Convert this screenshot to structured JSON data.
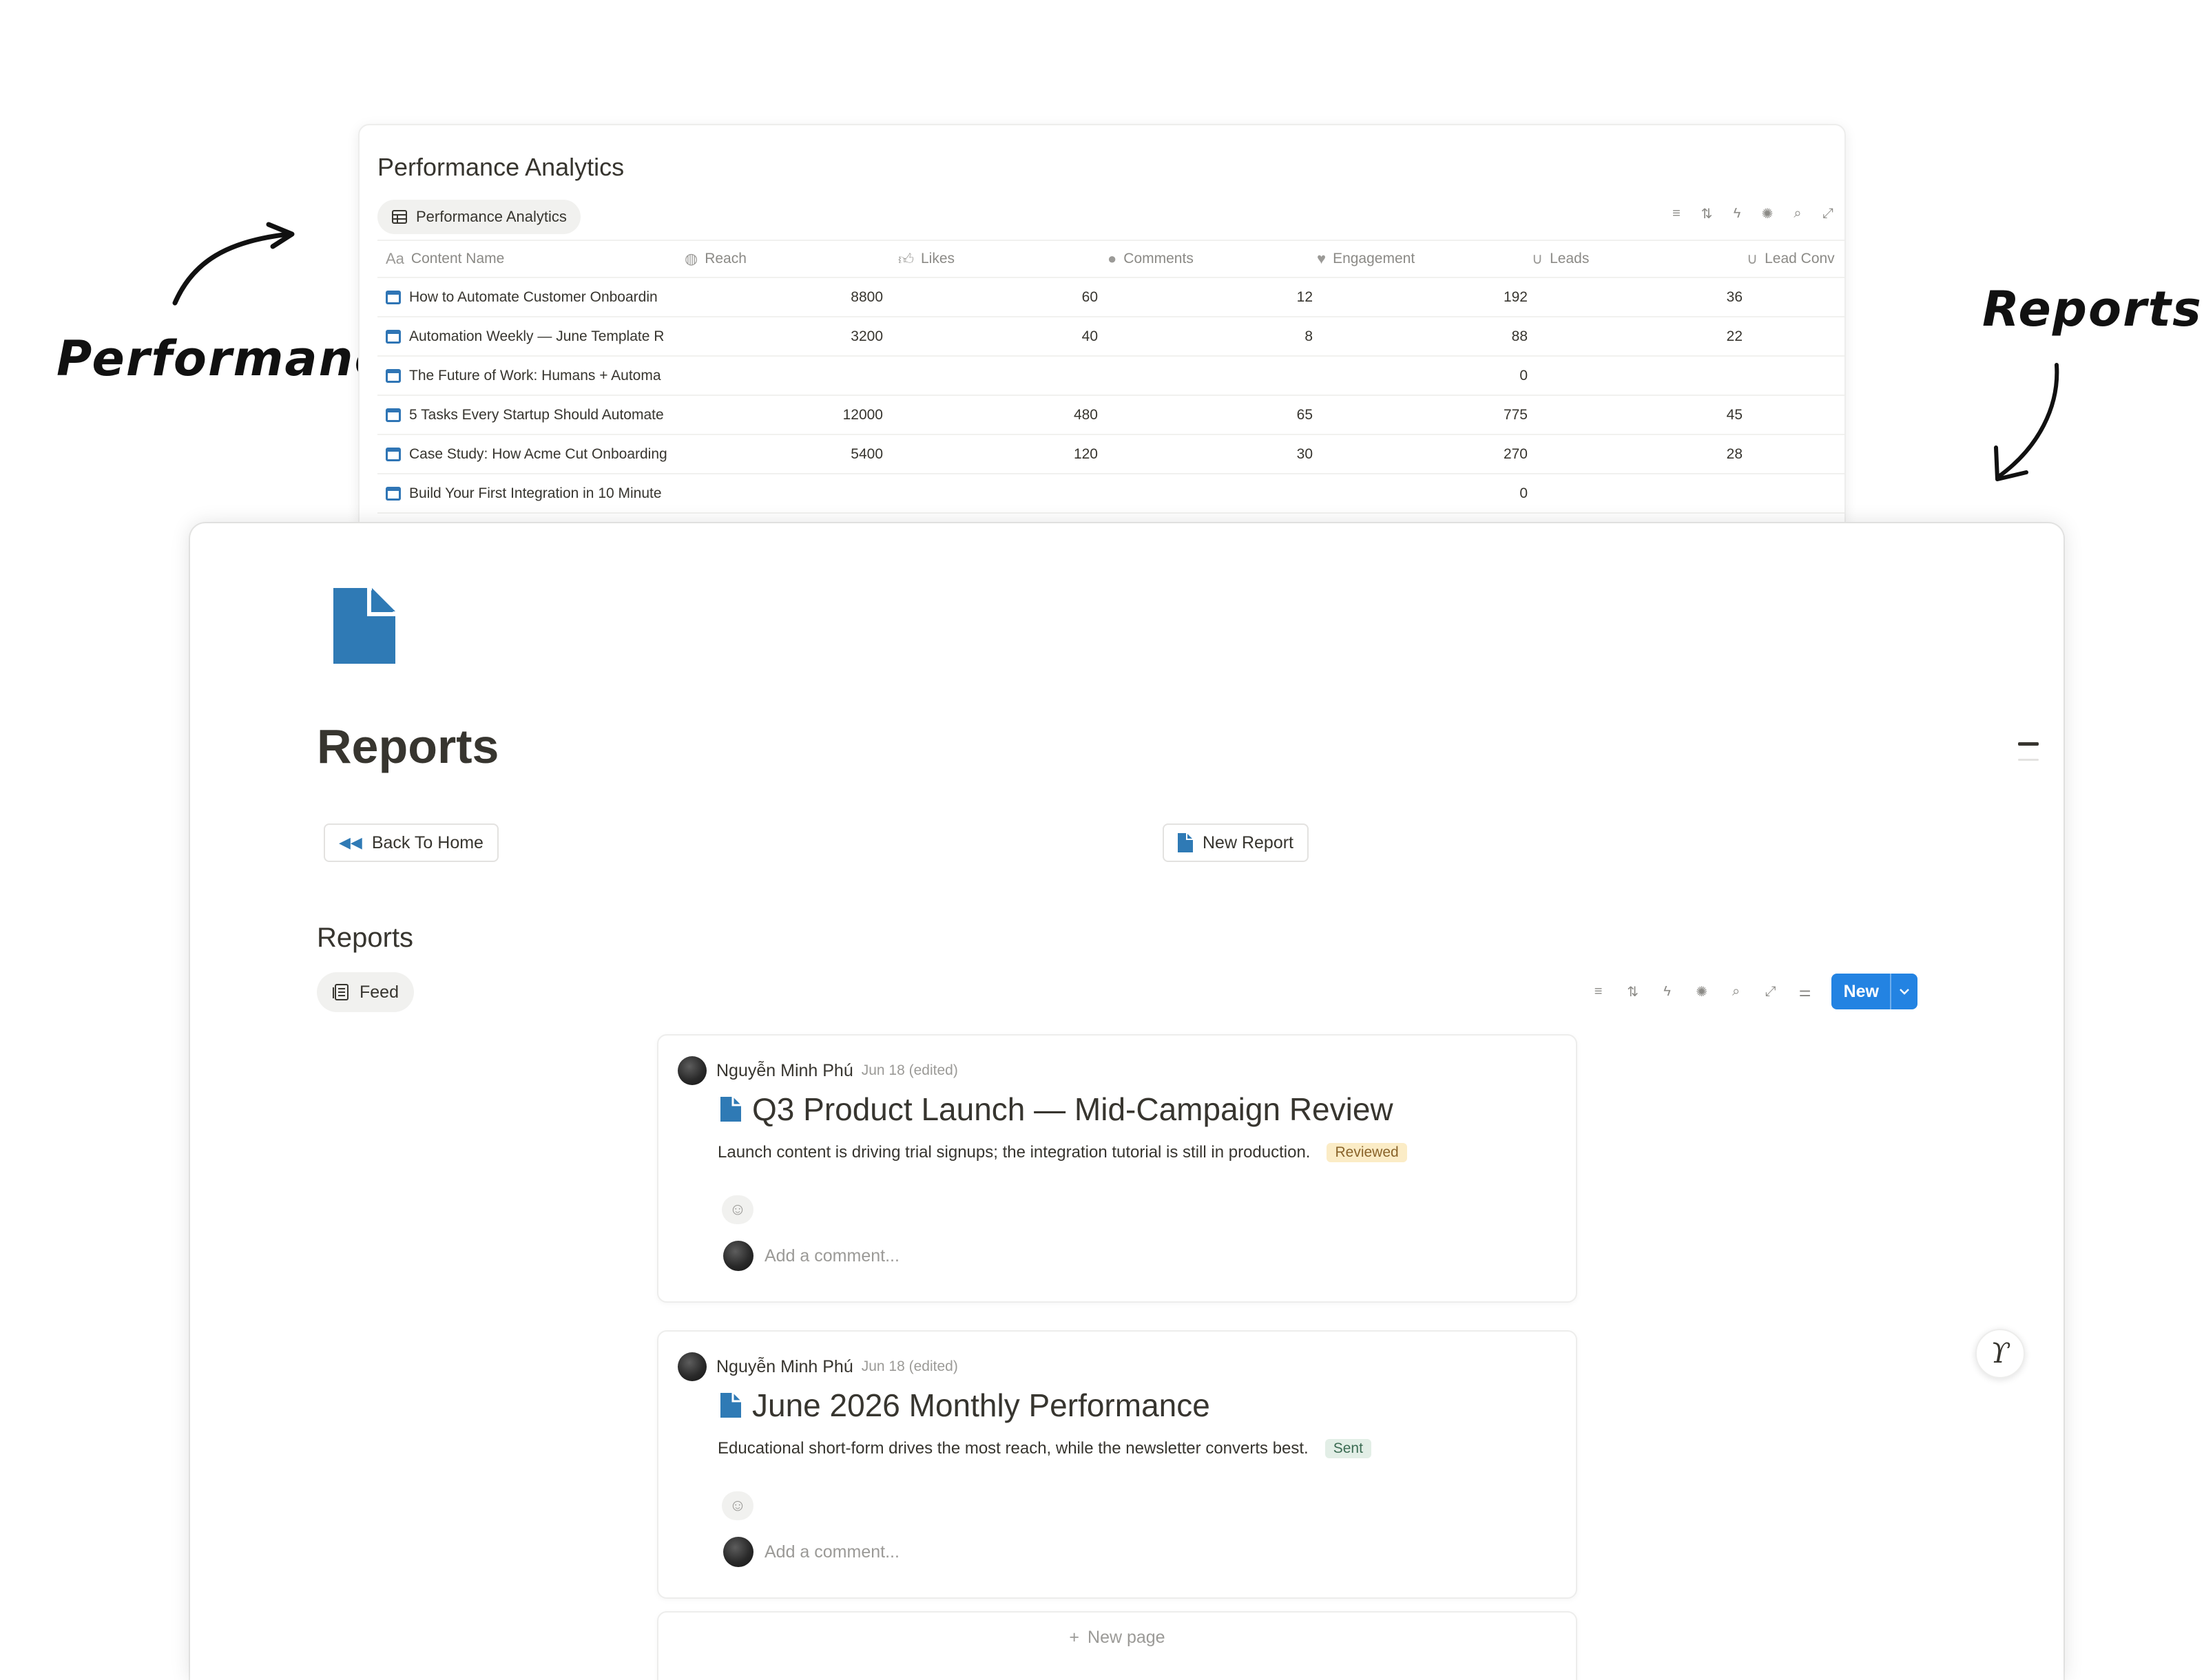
{
  "annotations": {
    "performance_label": "Performance",
    "reports_label": "Reports"
  },
  "performance": {
    "title": "Performance Analytics",
    "view_tab": "Performance Analytics",
    "columns": [
      {
        "label": "Content Name",
        "icon": "text-property-icon"
      },
      {
        "label": "Reach",
        "icon": "globe-icon"
      },
      {
        "label": "Likes",
        "icon": "thumbs-up-icon"
      },
      {
        "label": "Comments",
        "icon": "speech-bubble-icon"
      },
      {
        "label": "Engagement",
        "icon": "heart-icon"
      },
      {
        "label": "Leads",
        "icon": "magnet-icon"
      },
      {
        "label": "Lead Conv",
        "icon": "magnet-icon"
      }
    ],
    "rows": [
      {
        "name": "How to Automate Customer Onboardin",
        "reach": "8800",
        "likes": "60",
        "comments": "12",
        "engagement": "192",
        "leads": "36"
      },
      {
        "name": "Automation Weekly — June Template R",
        "reach": "3200",
        "likes": "40",
        "comments": "8",
        "engagement": "88",
        "leads": "22"
      },
      {
        "name": "The Future of Work: Humans + Automa",
        "reach": "",
        "likes": "",
        "comments": "",
        "engagement": "0",
        "leads": ""
      },
      {
        "name": "5 Tasks Every Startup Should Automate",
        "reach": "12000",
        "likes": "480",
        "comments": "65",
        "engagement": "775",
        "leads": "45"
      },
      {
        "name": "Case Study: How Acme Cut Onboarding",
        "reach": "5400",
        "likes": "120",
        "comments": "30",
        "engagement": "270",
        "leads": "28"
      },
      {
        "name": "Build Your First Integration in 10 Minute",
        "reach": "",
        "likes": "",
        "comments": "",
        "engagement": "0",
        "leads": ""
      }
    ]
  },
  "reports": {
    "title": "Reports",
    "back_button": "Back To Home",
    "new_report_button": "New Report",
    "section_title": "Reports",
    "feed_tab": "Feed",
    "new_button": "New",
    "accent": "#2383e2",
    "page_icon_color": "#2f7ab5",
    "posts": [
      {
        "author": "Nguyễn Minh Phú",
        "date": "Jun 18 (edited)",
        "title": "Q3 Product Launch — Mid-Campaign Review",
        "summary": "Launch content is driving trial signups; the integration tutorial is still in production.",
        "status": "Reviewed",
        "comment_placeholder": "Add a comment..."
      },
      {
        "author": "Nguyễn Minh Phú",
        "date": "Jun 18 (edited)",
        "title": "June 2026 Monthly Performance",
        "summary": "Educational short-form drives the most reach, while the newsletter converts best.",
        "status": "Sent",
        "comment_placeholder": "Add a comment..."
      }
    ],
    "new_page": "New page"
  }
}
